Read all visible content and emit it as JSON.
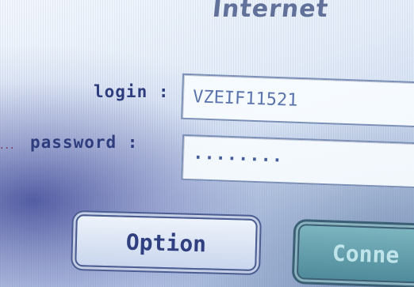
{
  "window": {
    "title": "Internet"
  },
  "form": {
    "login_label": "login :",
    "login_value": "VZEIF11521",
    "password_label": "password :",
    "password_value": "········",
    "leader_dots": "···"
  },
  "buttons": {
    "option_label": "Option",
    "connect_label": "Conne"
  }
}
